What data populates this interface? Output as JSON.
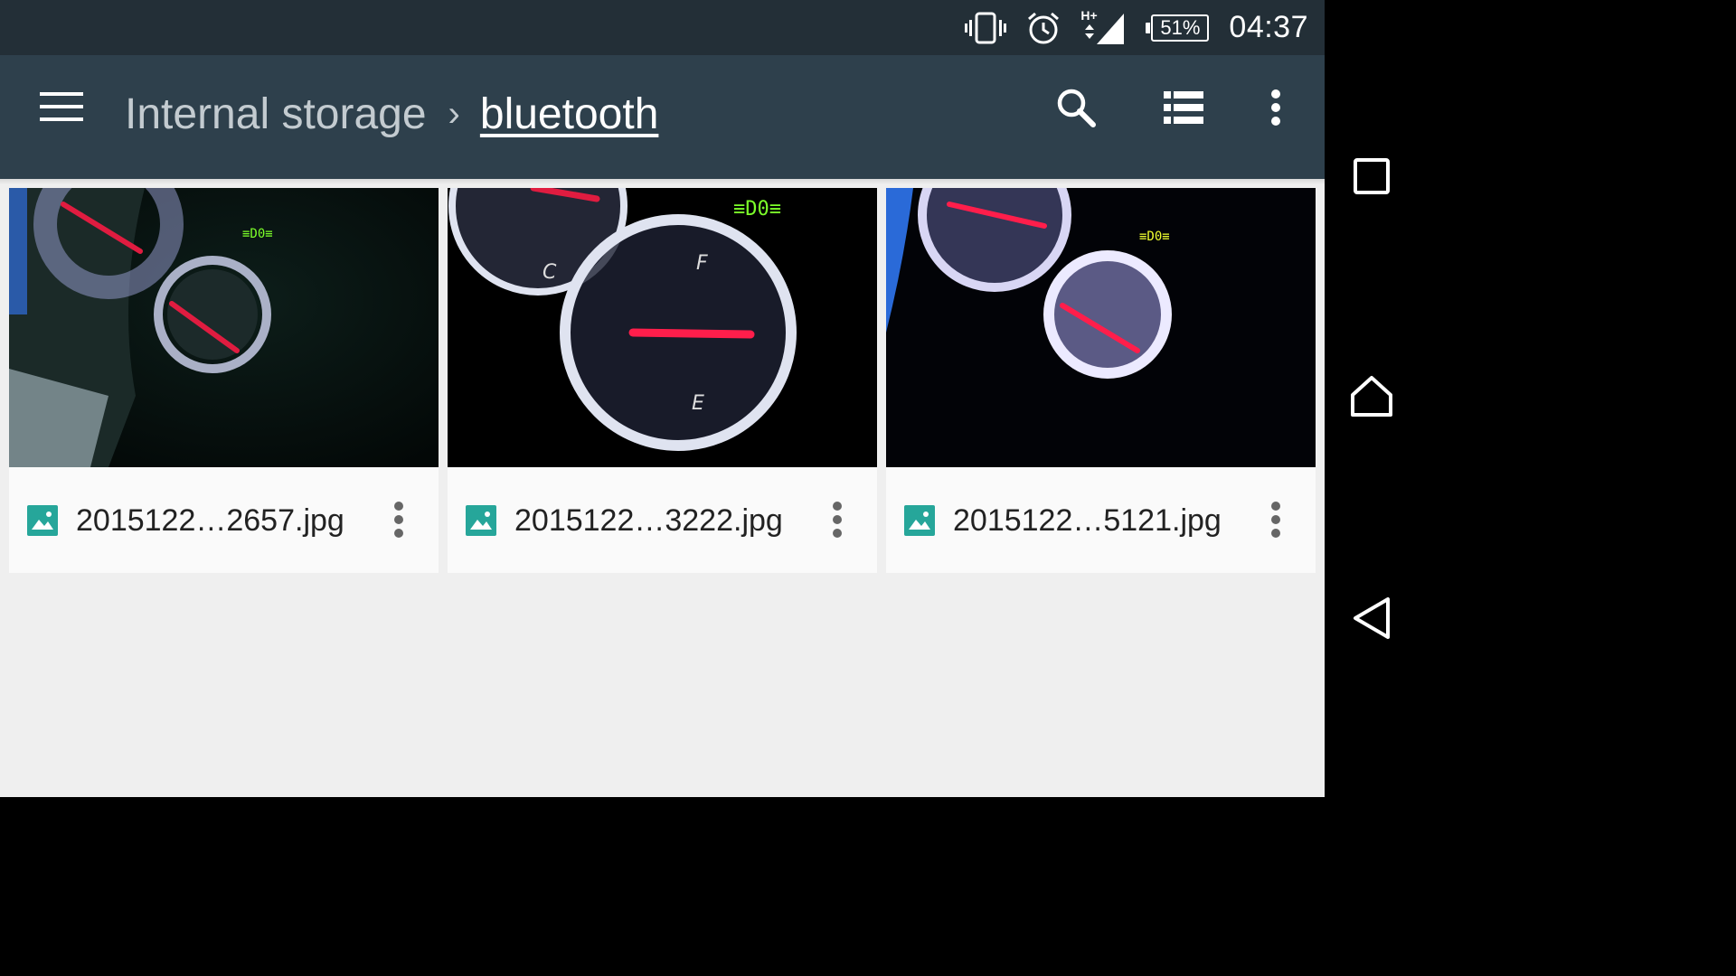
{
  "status_bar": {
    "icons": [
      "vibrate-icon",
      "alarm-icon",
      "signal-icon",
      "battery-icon"
    ],
    "network_label": "H+",
    "battery": "51%",
    "time": "04:37"
  },
  "toolbar": {
    "breadcrumb_root": "Internal storage",
    "breadcrumb_separator": "›",
    "breadcrumb_current": "bluetooth",
    "icons": [
      "menu-icon",
      "search-icon",
      "list-view-icon",
      "more-vert-icon"
    ]
  },
  "files": [
    {
      "name": "2015122…2657.jpg",
      "type_icon": "image-file-icon"
    },
    {
      "name": "2015122…3222.jpg",
      "type_icon": "image-file-icon"
    },
    {
      "name": "2015122…5121.jpg",
      "type_icon": "image-file-icon"
    }
  ],
  "nav_bar": {
    "icons": [
      "recents-icon",
      "home-icon",
      "back-icon"
    ]
  },
  "colors": {
    "status_bar": "#232f37",
    "toolbar": "#2e404c",
    "content_bg": "#efefef",
    "file_icon": "#26a69a"
  }
}
